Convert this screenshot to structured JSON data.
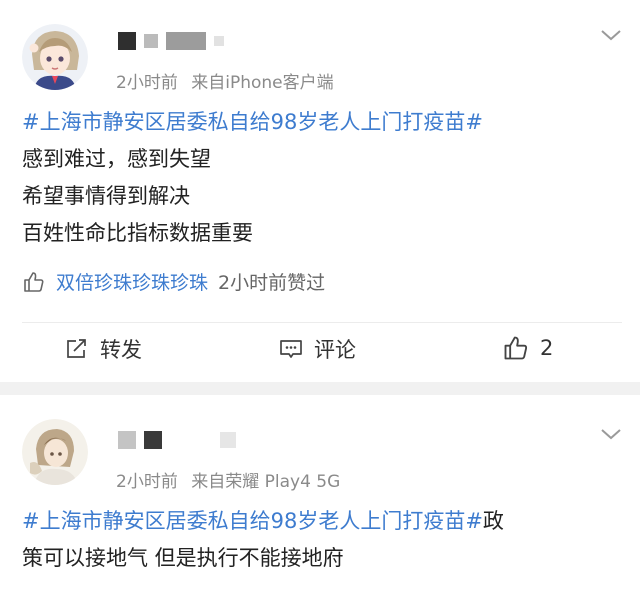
{
  "posts": [
    {
      "meta_time": "2小时前",
      "meta_source": "来自iPhone客户端",
      "topic": "#上海市静安区居委私自给98岁老人上门打疫苗#",
      "lines": [
        "感到难过，感到失望",
        "希望事情得到解决",
        "百姓性命比指标数据重要"
      ],
      "liked_by": "双倍珍珠珍珠珍珠",
      "liked_suffix": "2小时前赞过",
      "actions": {
        "repost": "转发",
        "comment": "评论",
        "like_count": "2"
      },
      "icons": [
        "thumb-up-icon",
        "repost-icon",
        "comment-icon",
        "chevron-down-icon"
      ]
    },
    {
      "meta_time": "2小时前",
      "meta_source": "来自荣耀 Play4 5G",
      "topic": "#上海市静安区居委私自给98岁老人上门打疫苗#",
      "topic_tail": "政",
      "line2": "策可以接地气 但是执行不能接地府",
      "icons": [
        "chevron-down-icon"
      ]
    }
  ],
  "colors": {
    "topic": "#3e7ccf",
    "meta": "#8a8a8a",
    "text": "#222222",
    "separator": "#f1f1f1"
  }
}
